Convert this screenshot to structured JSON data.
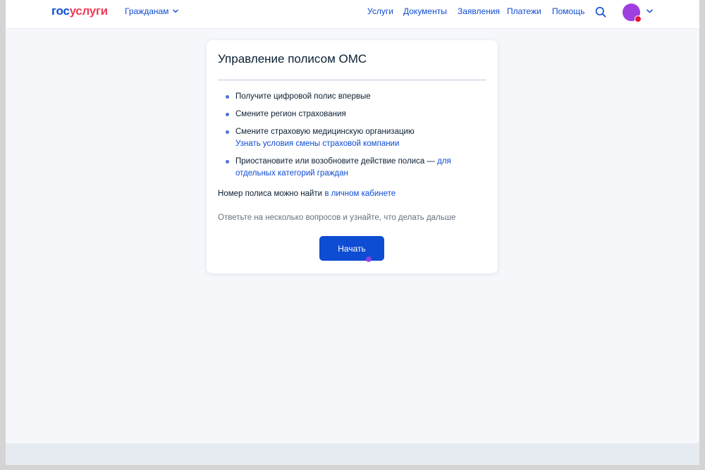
{
  "header": {
    "logo_part1": "гос",
    "logo_part2": "услуги",
    "audience_label": "Гражданам",
    "nav": {
      "services": "Услуги",
      "documents": "Документы",
      "applications": "Заявления",
      "payments": "Платежи",
      "help": "Помощь"
    },
    "icons": [
      "search-icon",
      "chevron-down-icon",
      "avatar"
    ]
  },
  "card": {
    "title": "Управление полисом ОМС",
    "bullets": [
      {
        "text": "Получите цифровой полис впервые"
      },
      {
        "text": "Смените регион страхования"
      },
      {
        "text": "Смените страховую медицинскую организацию",
        "link": "Узнать условия смены страховой компании"
      },
      {
        "text": "Приостановите или возобновите действие полиса — ",
        "link": "для отдельных категорий граждан"
      }
    ],
    "policy_note_text": "Номер полиса можно найти ",
    "policy_note_link": "в личном кабинете",
    "hint": "Ответьте на несколько вопросов и узнайте, что делать дальше",
    "start_button": "Начать"
  },
  "colors": {
    "brand_blue": "#0d4cd3",
    "brand_red": "#ee3f58",
    "avatar": "#a03fe0",
    "background": "#f5f7fb"
  }
}
